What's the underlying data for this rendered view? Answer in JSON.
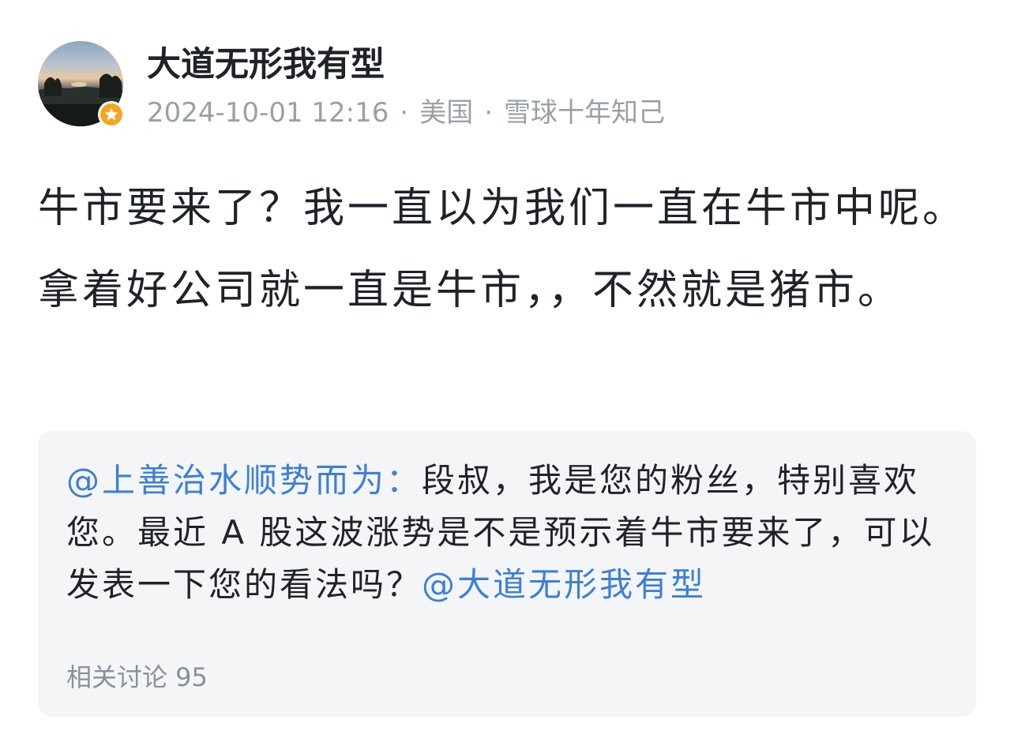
{
  "author": {
    "name": "大道无形我有型",
    "badge_icon": "star-icon",
    "badge_color": "#f4a623"
  },
  "meta": {
    "timestamp": "2024-10-01 12:16",
    "separator": "·",
    "location": "美国",
    "relation": "雪球十年知己"
  },
  "post": {
    "content": "牛市要来了？我一直以为我们一直在牛市中呢。拿着好公司就一直是牛市，，不然就是猪市。"
  },
  "quoted": {
    "mention_user": "@上善治水顺势而为：",
    "text": "段叔，我是您的粉丝，特别喜欢您。最近 A 股这波涨势是不是预示着牛市要来了，可以发表一下您的看法吗？",
    "trailing_mention": "@大道无形我有型",
    "related_label": "相关讨论 95"
  },
  "colors": {
    "accent": "#3d7fd6",
    "card_bg": "#f4f5f7",
    "meta_gray": "#9aa0a8"
  }
}
